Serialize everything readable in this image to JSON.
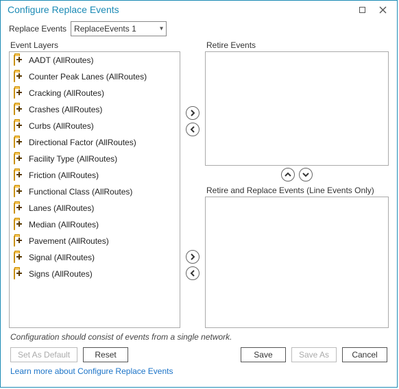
{
  "window": {
    "title": "Configure Replace Events"
  },
  "replace_events": {
    "label": "Replace Events",
    "selected": "ReplaceEvents 1"
  },
  "event_layers": {
    "label": "Event Layers",
    "items": [
      "AADT (AllRoutes)",
      "Counter Peak Lanes (AllRoutes)",
      "Cracking (AllRoutes)",
      "Crashes (AllRoutes)",
      "Curbs (AllRoutes)",
      "Directional Factor (AllRoutes)",
      "Facility Type (AllRoutes)",
      "Friction (AllRoutes)",
      "Functional Class (AllRoutes)",
      "Lanes (AllRoutes)",
      "Median (AllRoutes)",
      "Pavement (AllRoutes)",
      "Signal (AllRoutes)",
      "Signs (AllRoutes)"
    ]
  },
  "retire_events": {
    "label": "Retire Events"
  },
  "retire_replace": {
    "label": "Retire and Replace Events (Line Events Only)"
  },
  "note": "Configuration should consist of events from a single network.",
  "buttons": {
    "set_default": "Set As Default",
    "reset": "Reset",
    "save": "Save",
    "save_as": "Save As",
    "cancel": "Cancel"
  },
  "link": "Learn more about Configure Replace Events"
}
